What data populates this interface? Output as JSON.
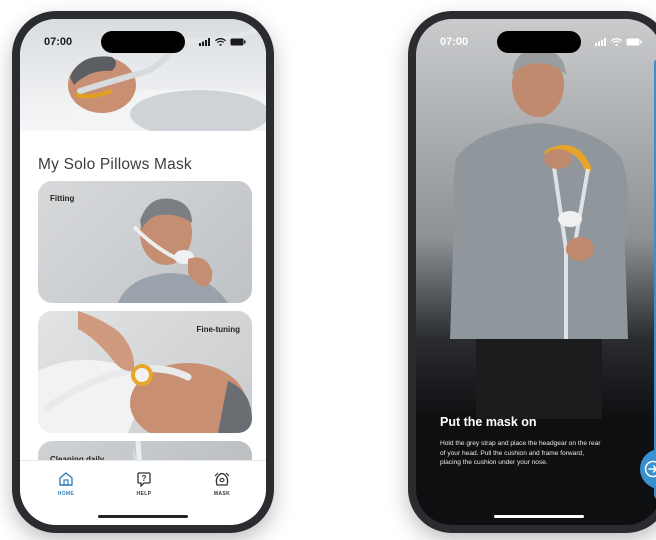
{
  "left_phone": {
    "status": {
      "time": "07:00"
    },
    "page_title": "My Solo Pillows Mask",
    "cards": [
      {
        "label": "Fitting"
      },
      {
        "label": "Fine-tuning"
      },
      {
        "label": "Cleaning daily"
      }
    ],
    "tabs": [
      {
        "label": "HOME",
        "icon": "home-icon",
        "active": true
      },
      {
        "label": "HELP",
        "icon": "help-icon",
        "active": false
      },
      {
        "label": "MASK",
        "icon": "mask-icon",
        "active": false
      }
    ],
    "accent": "#2f7fb8"
  },
  "right_phone": {
    "status": {
      "time": "07:00"
    },
    "title": "Put the mask on",
    "body": "Hold the grey strap and place the headgear on the rear of your head. Pull the cushion and frame forward, placing the cushion under your nose.",
    "next_icon": "arrow-right-circle-icon",
    "accent": "#3a8fcf"
  }
}
